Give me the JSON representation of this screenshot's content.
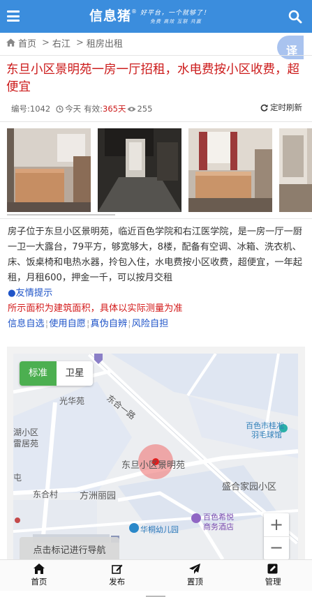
{
  "header": {
    "logo": "信息猪",
    "logo_mark": "®",
    "slogan_line1": "好平台，一个就够了！",
    "slogan_line2": "免费 高效 互联 共赢",
    "menu_icon": "hamburger-icon",
    "search_icon": "search-icon"
  },
  "breadcrumb": {
    "home": "首页",
    "items": [
      "右江",
      "租房出租"
    ],
    "separator": ">"
  },
  "translate": {
    "label": "译"
  },
  "listing": {
    "title": "东旦小区景明苑一房一厅招租，水电费按小区收费，超便宜",
    "id_label": "编号:1042",
    "time_label": "今天",
    "valid_label": "有效:",
    "valid_value": "365天",
    "views": "255",
    "refresh_label": "定时刷新"
  },
  "description": {
    "text": "房子位于东旦小区景明苑，临近百色学院和右江医学院，是一房一厅一厨一卫一大露台，79平方，够宽够大，8楼，配备有空调、冰箱、洗衣机、床、饭桌椅和电热水器，拎包入住，水电费按小区收费，超便宜，一年起租，月租600，押金一千，可以按月交租",
    "tip": "●友情提示",
    "warning": "所示面积为建筑面积，具体以实际测量为准",
    "links": [
      "信息自选",
      "使用自愿",
      "真伪自辨",
      "风险自担"
    ]
  },
  "map": {
    "toggle_standard": "标准",
    "toggle_satellite": "卫星",
    "labels": {
      "guanghua": "光华苑",
      "donghe_road": "东合一路",
      "huxiaoqu": "湖小区",
      "juyuan": "雷居苑",
      "baise_city": "百色市桂凇",
      "badminton": "羽毛球馆",
      "location": "东旦小区景明苑",
      "tun": "屯",
      "donghecun": "东合村",
      "fangcheng": "方洲丽园",
      "shenghe": "盛合家园小区",
      "hotel1": "百色希悦",
      "hotel2": "商务酒店",
      "kindergarten": "华桐幼儿园"
    },
    "zoom_in": "+",
    "zoom_out": "−",
    "nav_button": "点击标记进行导航"
  },
  "bottom_nav": [
    {
      "label": "首页",
      "icon": "home-icon"
    },
    {
      "label": "发布",
      "icon": "edit-icon"
    },
    {
      "label": "置顶",
      "icon": "send-icon"
    },
    {
      "label": "管理",
      "icon": "manage-icon"
    }
  ],
  "colors": {
    "header": "#3b8ddd",
    "title": "#cc1b1b",
    "link": "#1f54c8",
    "map_toggle_active": "#4caf50"
  }
}
